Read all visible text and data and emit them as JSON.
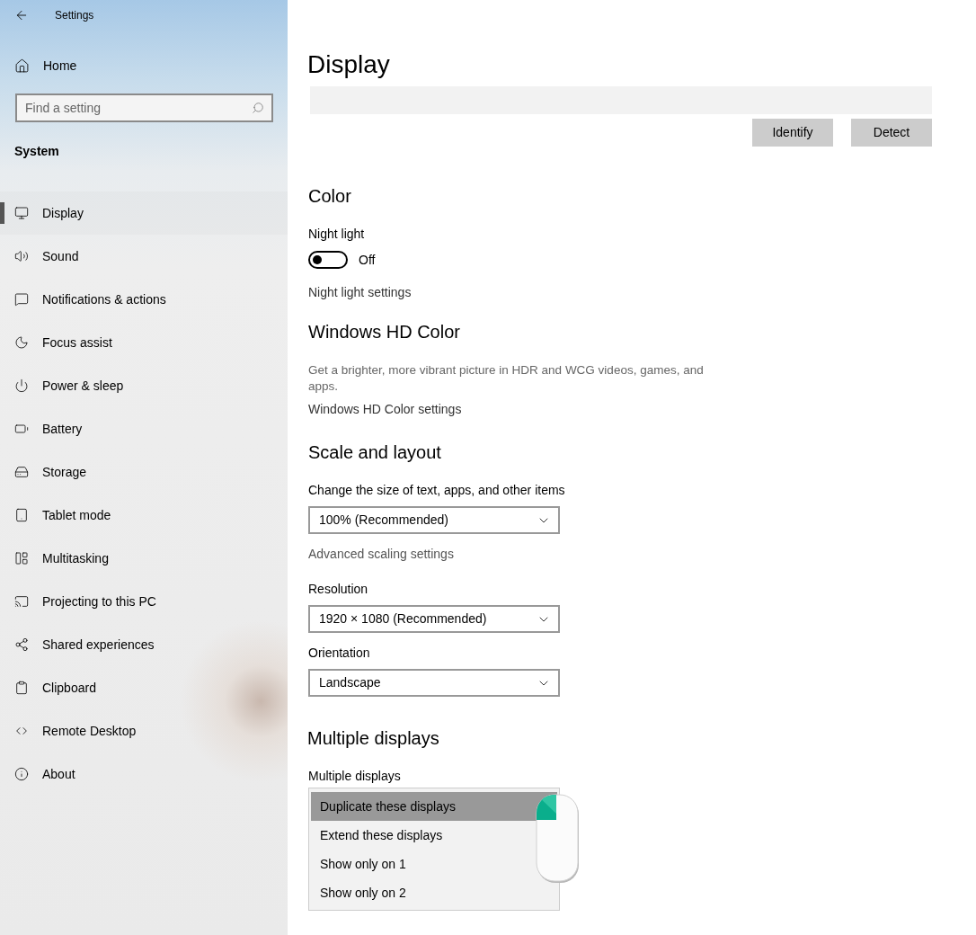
{
  "window": {
    "title": "Settings"
  },
  "sidebar": {
    "home": "Home",
    "search": {
      "placeholder": "Find a setting"
    },
    "section": "System",
    "items": [
      {
        "label": "Display",
        "selected": true
      },
      {
        "label": "Sound",
        "selected": false
      },
      {
        "label": "Notifications & actions",
        "selected": false
      },
      {
        "label": "Focus assist",
        "selected": false
      },
      {
        "label": "Power & sleep",
        "selected": false
      },
      {
        "label": "Battery",
        "selected": false
      },
      {
        "label": "Storage",
        "selected": false
      },
      {
        "label": "Tablet mode",
        "selected": false
      },
      {
        "label": "Multitasking",
        "selected": false
      },
      {
        "label": "Projecting to this PC",
        "selected": false
      },
      {
        "label": "Shared experiences",
        "selected": false
      },
      {
        "label": "Clipboard",
        "selected": false
      },
      {
        "label": "Remote Desktop",
        "selected": false
      },
      {
        "label": "About",
        "selected": false
      }
    ]
  },
  "page": {
    "title": "Display",
    "buttons": [
      "Identify",
      "Detect"
    ],
    "color": {
      "heading": "Color",
      "night_light_label": "Night light",
      "night_light": {
        "on": false,
        "state": "Off"
      },
      "link": "Night light settings"
    },
    "hd_color": {
      "heading": "Windows HD Color",
      "description": "Get a brighter, more vibrant picture in HDR and WCG videos, games, and apps.",
      "link": "Windows HD Color settings"
    },
    "scale": {
      "heading": "Scale and layout",
      "size_label": "Change the size of text, apps, and other items",
      "size_value": "100% (Recommended)",
      "link": "Advanced scaling settings",
      "resolution_label": "Resolution",
      "resolution_value": "1920 × 1080 (Recommended)",
      "orientation_label": "Orientation",
      "orientation_value": "Landscape"
    },
    "multiple": {
      "heading": "Multiple displays",
      "label": "Multiple displays",
      "options": [
        {
          "label": "Duplicate these displays",
          "selected": true
        },
        {
          "label": "Extend these displays",
          "selected": false
        },
        {
          "label": "Show only on 1",
          "selected": false
        },
        {
          "label": "Show only on 2",
          "selected": false
        }
      ]
    }
  }
}
